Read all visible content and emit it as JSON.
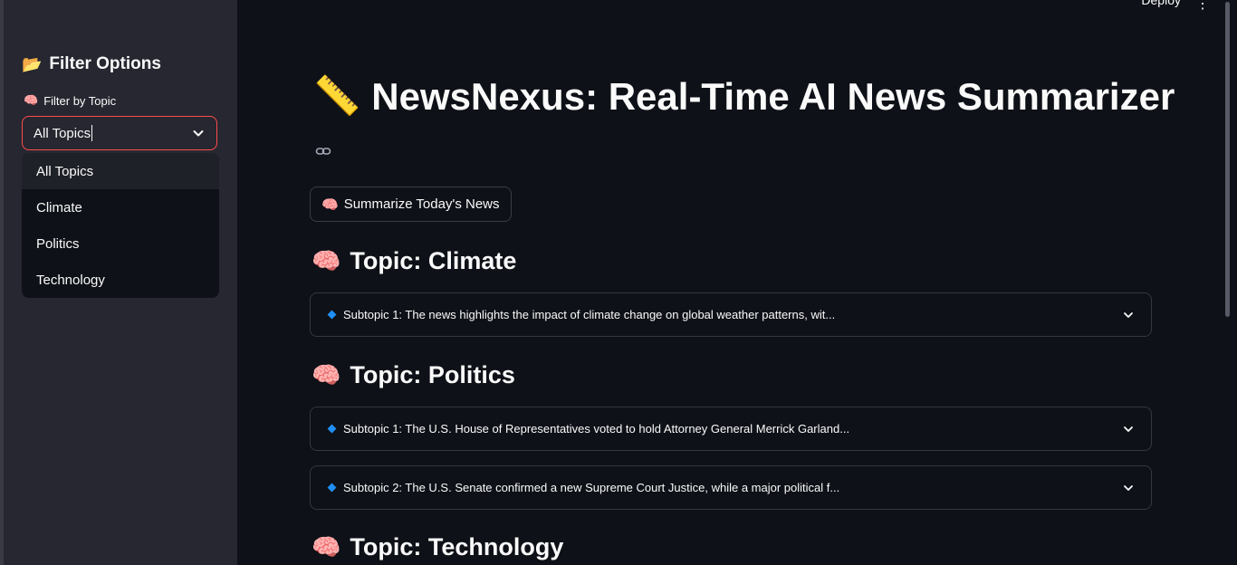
{
  "header": {
    "deploy_label": "Deploy",
    "menu_glyph": "⋮"
  },
  "sidebar": {
    "title_emoji": "📂",
    "title": "Filter Options",
    "filter_emoji": "🧠",
    "filter_label": "Filter by Topic",
    "select_value": "All Topics",
    "options": [
      "All Topics",
      "Climate",
      "Politics",
      "Technology"
    ]
  },
  "main": {
    "title_emoji": "📏",
    "title": "NewsNexus: Real-Time AI News Summarizer",
    "button_emoji": "🧠",
    "button_label": "Summarize Today's News",
    "topic_emoji": "🧠",
    "topics": [
      {
        "heading": "Topic: Climate",
        "subtopics": [
          "Subtopic 1: The news highlights the impact of climate change on global weather patterns, wit..."
        ]
      },
      {
        "heading": "Topic: Politics",
        "subtopics": [
          "Subtopic 1: The U.S. House of Representatives voted to hold Attorney General Merrick Garland...",
          "Subtopic 2: The U.S. Senate confirmed a new Supreme Court Justice, while a major political f..."
        ]
      },
      {
        "heading": "Topic: Technology",
        "subtopics": []
      }
    ]
  },
  "colors": {
    "accent": "#ff4b4b",
    "background": "#0e1117",
    "sidebar": "#262730",
    "bullet": "#1f8ff5"
  }
}
